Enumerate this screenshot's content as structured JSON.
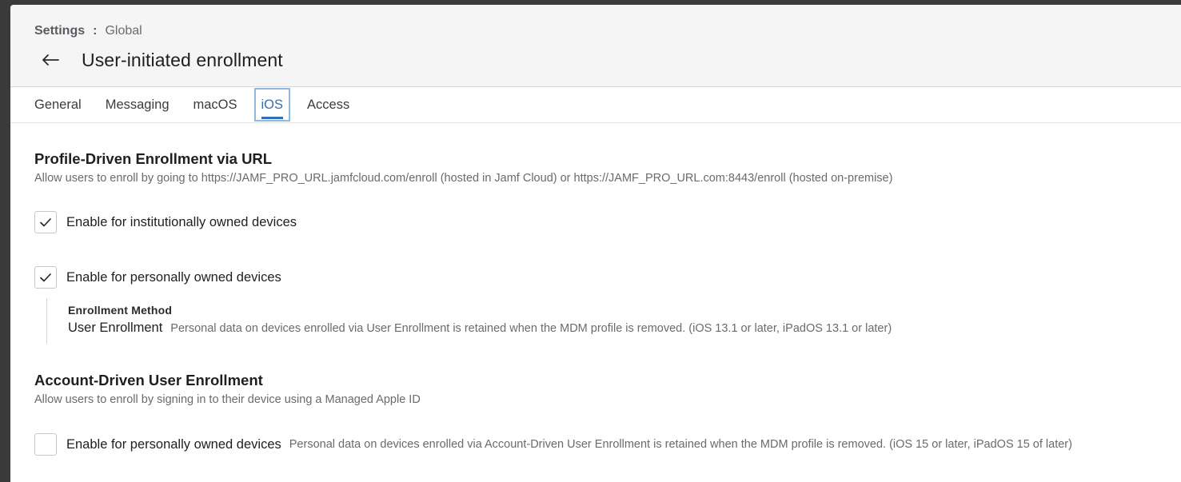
{
  "breadcrumb": {
    "root": "Settings",
    "separator": ":",
    "current": "Global"
  },
  "page": {
    "title": "User-initiated enrollment"
  },
  "tabs": [
    {
      "label": "General"
    },
    {
      "label": "Messaging"
    },
    {
      "label": "macOS"
    },
    {
      "label": "iOS",
      "active": true
    },
    {
      "label": "Access"
    }
  ],
  "profile_section": {
    "title": "Profile-Driven Enrollment via URL",
    "description": "Allow users to enroll by going to https://JAMF_PRO_URL.jamfcloud.com/enroll (hosted in Jamf Cloud) or https://JAMF_PRO_URL.com:8443/enroll (hosted on-premise)",
    "institutional": {
      "label": "Enable for institutionally owned devices",
      "checked": true
    },
    "personal": {
      "label": "Enable for personally owned devices",
      "checked": true
    },
    "method": {
      "heading": "Enrollment Method",
      "value": "User Enrollment",
      "note": "Personal data on devices enrolled via User Enrollment is retained when the MDM profile is removed. (iOS 13.1 or later, iPadOS 13.1 or later)"
    }
  },
  "account_section": {
    "title": "Account-Driven User Enrollment",
    "description": "Allow users to enroll by signing in to their device using a Managed Apple ID",
    "personal": {
      "label": "Enable for personally owned devices",
      "checked": false,
      "note": "Personal data on devices enrolled via Account-Driven User Enrollment is retained when the MDM profile is removed. (iOS 15 or later, iPadOS 15 of later)"
    }
  },
  "colors": {
    "accent": "#2f6fb6",
    "accent_outline": "#8fb8e5",
    "header_bg": "#f5f5f6"
  }
}
